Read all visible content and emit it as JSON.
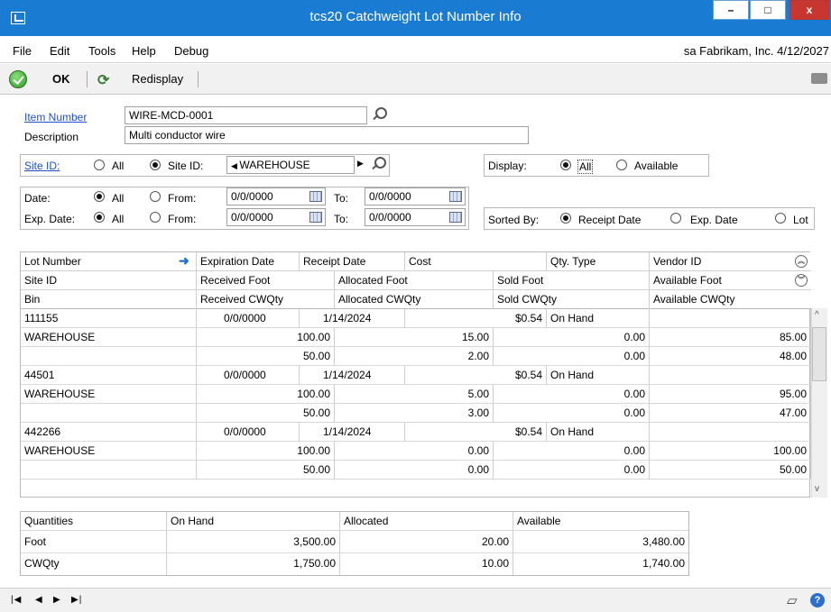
{
  "window": {
    "title": "tcs20 Catchweight Lot Number Info",
    "minimize": "–",
    "maximize": "□",
    "close": "x"
  },
  "menu": {
    "items": [
      "File",
      "Edit",
      "Tools",
      "Help",
      "Debug"
    ],
    "company_info": "sa  Fabrikam, Inc.  4/12/2027"
  },
  "toolbar": {
    "ok_label": "OK",
    "redisplay_label": "Redisplay"
  },
  "form": {
    "item_number_label": "Item Number",
    "item_number_value": "WIRE-MCD-0001",
    "description_label": "Description",
    "description_value": "Multi conductor wire",
    "site_id_label": "Site ID:",
    "site_all_label": "All",
    "site_id_option_label": "Site ID:",
    "site_id_value": "WAREHOUSE",
    "display_label": "Display:",
    "display_all_label": "All",
    "display_available_label": "Available",
    "date_label": "Date:",
    "date_all_label": "All",
    "date_from_label": "From:",
    "date_from_value": "0/0/0000",
    "date_to_label": "To:",
    "date_to_value": "0/0/0000",
    "exp_date_label": "Exp. Date:",
    "exp_all_label": "All",
    "exp_from_label": "From:",
    "exp_from_value": "0/0/0000",
    "exp_to_label": "To:",
    "exp_to_value": "0/0/0000",
    "sorted_by_label": "Sorted By:",
    "sort_receipt_label": "Receipt Date",
    "sort_exp_label": "Exp. Date",
    "sort_lot_label": "Lot"
  },
  "grid": {
    "header1": [
      "Lot Number",
      "Expiration Date",
      "Receipt Date",
      "Cost",
      "Qty. Type",
      "Vendor ID"
    ],
    "header2": [
      "Site ID",
      "Received Foot",
      "Allocated Foot",
      "Sold Foot",
      "Available Foot"
    ],
    "header3": [
      "Bin",
      "Received CWQty",
      "Allocated CWQty",
      "Sold CWQty",
      "Available CWQty"
    ],
    "lots": [
      {
        "lot": "111155",
        "exp": "0/0/0000",
        "receipt": "1/14/2024",
        "cost": "$0.54",
        "qty_type": "On Hand",
        "site": "WAREHOUSE",
        "rf": "100.00",
        "af": "15.00",
        "sf": "0.00",
        "avf": "85.00",
        "bin": "",
        "rc": "50.00",
        "ac": "2.00",
        "sc": "0.00",
        "avc": "48.00"
      },
      {
        "lot": "44501",
        "exp": "0/0/0000",
        "receipt": "1/14/2024",
        "cost": "$0.54",
        "qty_type": "On Hand",
        "site": "WAREHOUSE",
        "rf": "100.00",
        "af": "5.00",
        "sf": "0.00",
        "avf": "95.00",
        "bin": "",
        "rc": "50.00",
        "ac": "3.00",
        "sc": "0.00",
        "avc": "47.00"
      },
      {
        "lot": "442266",
        "exp": "0/0/0000",
        "receipt": "1/14/2024",
        "cost": "$0.54",
        "qty_type": "On Hand",
        "site": "WAREHOUSE",
        "rf": "100.00",
        "af": "0.00",
        "sf": "0.00",
        "avf": "100.00",
        "bin": "",
        "rc": "50.00",
        "ac": "0.00",
        "sc": "0.00",
        "avc": "50.00"
      }
    ]
  },
  "totals": {
    "headers": [
      "Quantities",
      "On Hand",
      "Allocated",
      "Available"
    ],
    "rows": [
      {
        "label": "Foot",
        "on_hand": "3,500.00",
        "allocated": "20.00",
        "available": "3,480.00"
      },
      {
        "label": "CWQty",
        "on_hand": "1,750.00",
        "allocated": "10.00",
        "available": "1,740.00"
      }
    ]
  },
  "icons": {
    "ok": "ok-check-icon",
    "redisplay": "redisplay-icon",
    "lookup": "magnifier-icon",
    "calendar": "calendar-icon"
  }
}
